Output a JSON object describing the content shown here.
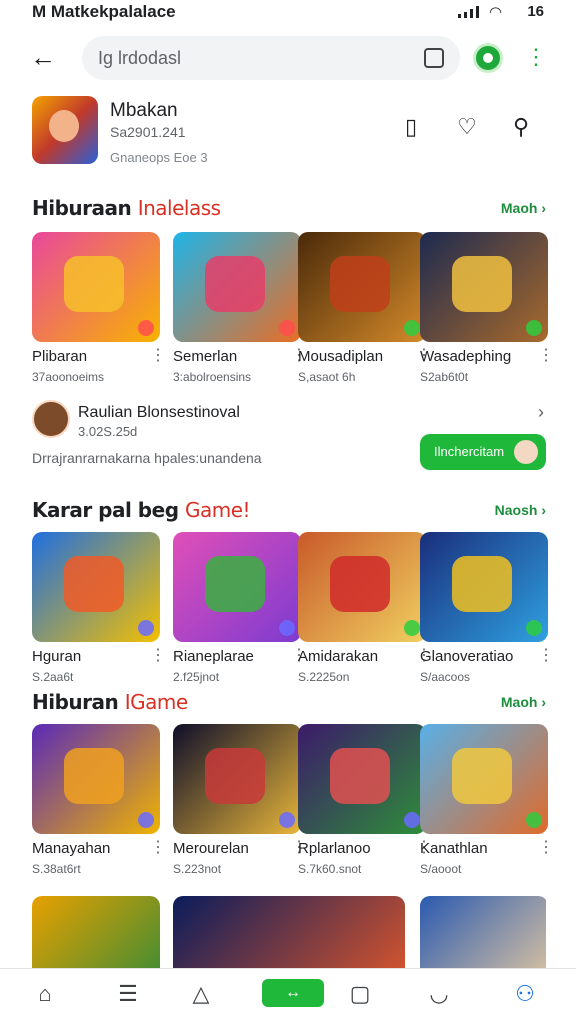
{
  "status": {
    "title": "M Matkekpalalace",
    "right": "16"
  },
  "search": {
    "text": "Ig lrdodasl"
  },
  "app": {
    "name": "Mbakan",
    "sub": "Sa2901.241",
    "meta": "Gnaneops Eoe 3"
  },
  "sections": [
    {
      "title_a": "Hiburaan ",
      "title_b": "Inalelass",
      "more": "Maoh ›",
      "items": [
        {
          "title": "Plibaran",
          "size": "37aoonoeims",
          "c1": "#e9489b",
          "c2": "#f7b300",
          "b": "#ff4d4d"
        },
        {
          "title": "Semerlan",
          "size": "3:abolroensins",
          "c1": "#1fb4e8",
          "c2": "#ec6d24",
          "b": "#ff4d4d"
        },
        {
          "title": "Mousadiplan",
          "size": "S,asaot 6h",
          "c1": "#4a2a0a",
          "c2": "#d48a2a",
          "b": "#2ecc40"
        },
        {
          "title": "Wasadephing",
          "size": "S2ab6t0t",
          "c1": "#1d2a50",
          "c2": "#a86a2c",
          "b": "#2ecc40"
        }
      ]
    },
    {
      "title_a": "Karar pal beg ",
      "title_b": "Game!",
      "more": "Naosh ›",
      "items": [
        {
          "title": "Hguran",
          "size": "S.2aa6t",
          "c1": "#1f6fe0",
          "c2": "#f4c000",
          "b": "#6a6aff"
        },
        {
          "title": "Rianeplarae",
          "size": "2.f25jnot",
          "c1": "#e04fb8",
          "c2": "#7d3bd1",
          "b": "#6a6aff"
        },
        {
          "title": "Amidarakan",
          "size": "S.2225on",
          "c1": "#c85a2a",
          "c2": "#f0d060",
          "b": "#2ecc40"
        },
        {
          "title": "Glanoveratiao",
          "size": "S/aacoos",
          "c1": "#1a2e7c",
          "c2": "#2fa0e0",
          "b": "#2ecc40"
        }
      ]
    },
    {
      "title_a": "Hiburan ",
      "title_b": "IGame",
      "more": "Maoh ›",
      "items": [
        {
          "title": "Manayahan",
          "size": "S.38at6rt",
          "c1": "#5a2ab8",
          "c2": "#f0b400",
          "b": "#6a6aff"
        },
        {
          "title": "Merourelan",
          "size": "S.223not",
          "c1": "#0e0e2a",
          "c2": "#e8b63a",
          "b": "#6a6aff"
        },
        {
          "title": "Rplarlanoo",
          "size": "S.7k60.snot",
          "c1": "#3c1a6a",
          "c2": "#2e8e3a",
          "b": "#6a6aff"
        },
        {
          "title": "Kanathlan",
          "size": "S/aooot",
          "c1": "#58b0e8",
          "c2": "#e06a2a",
          "b": "#2ecc40"
        }
      ]
    },
    {
      "items": [
        {
          "c1": "#e8a000",
          "c2": "#2a8a3a"
        },
        {
          "c1": "#0a1c5c",
          "c2": "#e85a2a"
        },
        {
          "c1": "#2a5ab0",
          "c2": "#f0d0a0"
        }
      ]
    }
  ],
  "featured": {
    "name": "Raulian Blonsestinoval",
    "stat": "3.02S.25d",
    "desc": "Drrajranrarnakarna hpales:unandena",
    "button": "Ilnchercitam"
  }
}
